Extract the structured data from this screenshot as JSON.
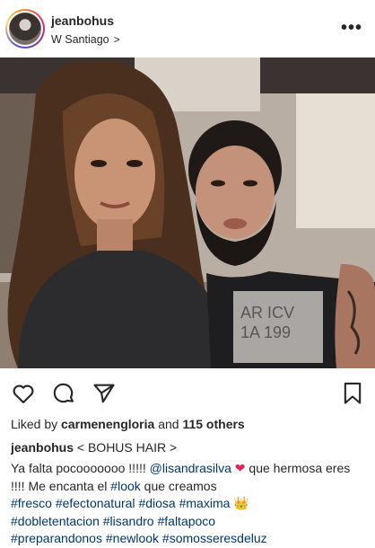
{
  "header": {
    "username": "jeanbohus",
    "location": "W Santiago",
    "location_chevron": ">",
    "more_label": "•••"
  },
  "colors": {
    "link": "#00376b",
    "text": "#262626",
    "heart": "#e0245e"
  },
  "actions": {
    "like_icon": "heart-outline-icon",
    "comment_icon": "comment-icon",
    "share_icon": "paper-plane-icon",
    "save_icon": "bookmark-icon"
  },
  "likes": {
    "prefix": "Liked by ",
    "user": "carmenengloria",
    "middle": " and ",
    "others": "115 others"
  },
  "caption": {
    "username": "jeanbohus",
    "headline": "< BOHUS HAIR >",
    "line1_a": "Ya falta pocooooooo !!!!! ",
    "mention": "@lisandrasilva",
    "heart": "❤",
    "line1_b": " que hermosa eres !!!! Me encanta el ",
    "tag_look": "#look",
    "line1_c": " que creamos",
    "tags_row1": [
      "#fresco",
      "#efectonatural",
      "#diosa",
      "#maxima"
    ],
    "crown": "👑",
    "tags_row2": [
      "#dobletentacion",
      "#lisandro",
      "#faltapoco"
    ],
    "tags_row3": [
      "#preparandonos",
      "#newlook",
      "#somosseresdeluz"
    ]
  }
}
